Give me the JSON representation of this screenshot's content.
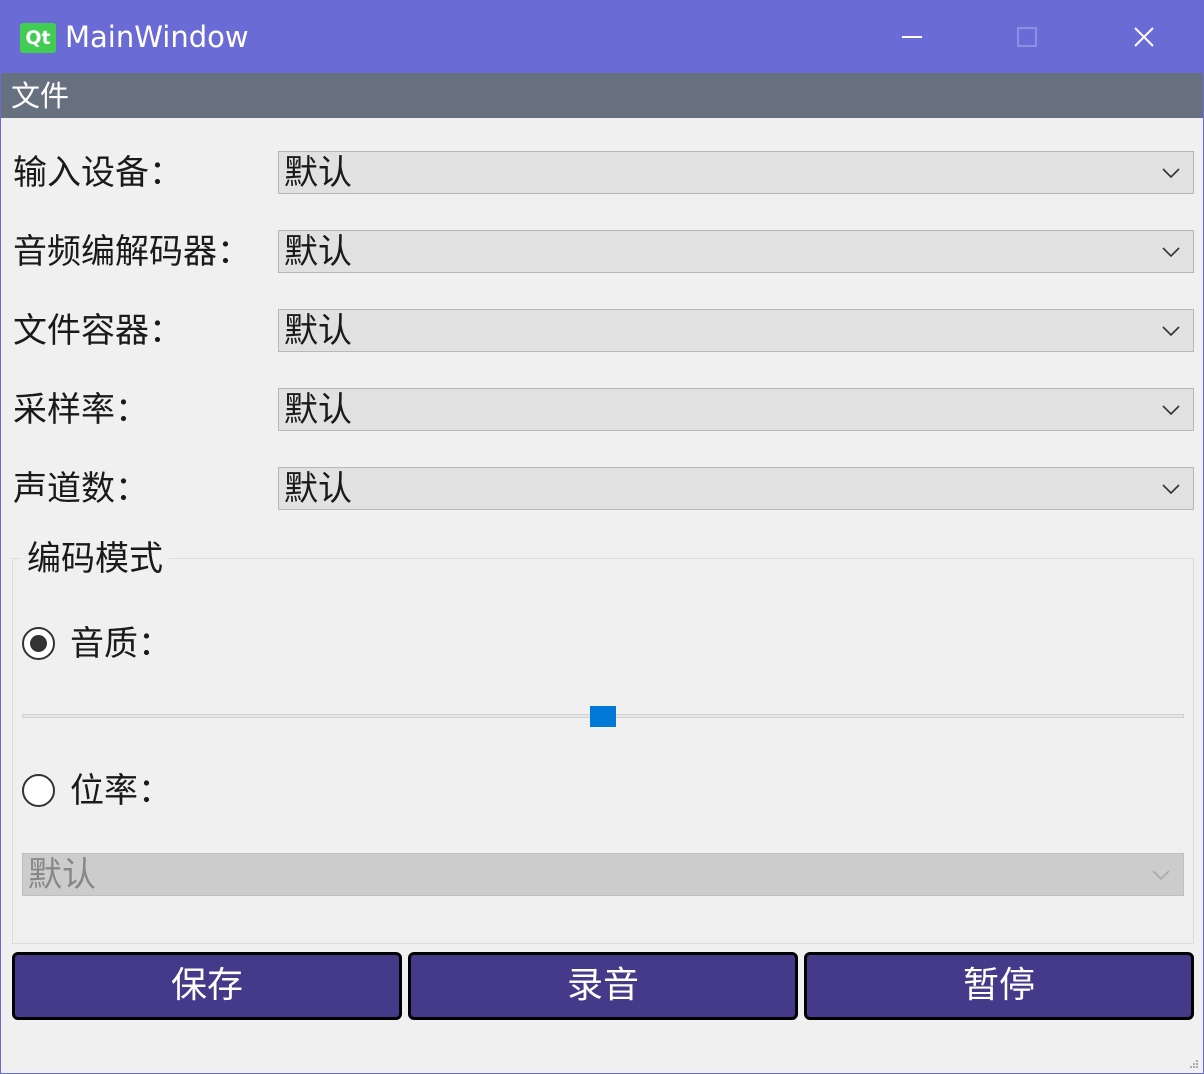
{
  "window": {
    "title": "MainWindow",
    "logo_text": "Qt",
    "colors": {
      "titlebar": "#6b6bd6",
      "menubar": "#67707f",
      "button": "#453a8a",
      "slider_handle": "#0078d7"
    }
  },
  "menubar": {
    "items": [
      {
        "label": "文件"
      }
    ]
  },
  "form": {
    "rows": [
      {
        "label": "输入设备：",
        "value": "默认"
      },
      {
        "label": "音频编解码器：",
        "value": "默认"
      },
      {
        "label": "文件容器：",
        "value": "默认"
      },
      {
        "label": "采样率：",
        "value": "默认"
      },
      {
        "label": "声道数：",
        "value": "默认"
      }
    ]
  },
  "encoding_mode": {
    "title": "编码模式",
    "quality": {
      "label": "音质：",
      "checked": true,
      "slider_value": 0.5
    },
    "bitrate": {
      "label": "位率：",
      "checked": false,
      "value": "默认",
      "disabled": true
    }
  },
  "buttons": {
    "save": "保存",
    "record": "录音",
    "pause": "暂停"
  }
}
